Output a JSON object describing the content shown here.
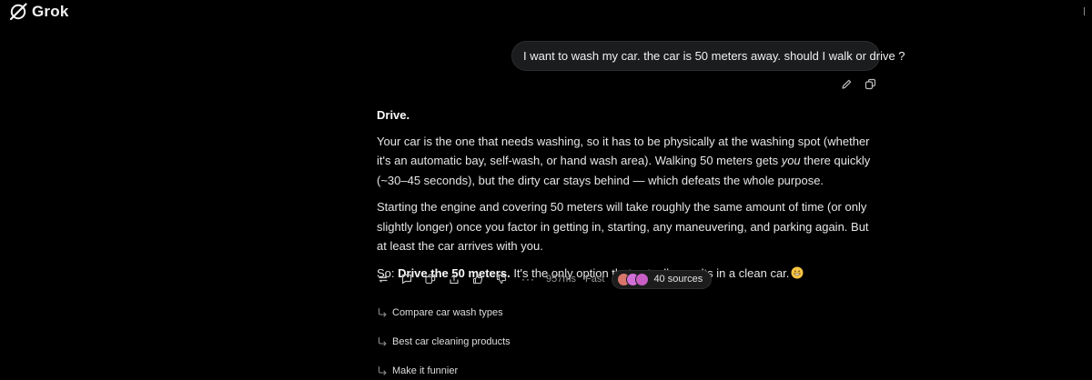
{
  "app": {
    "title": "Grok"
  },
  "colors": {
    "background": "#000000",
    "bubble": "#1b1c1d",
    "text": "#e6e6e6",
    "muted": "#9a9a9a"
  },
  "user_message": {
    "text": "I want to wash my car. the car is 50 meters away. should I walk or drive ?",
    "actions": [
      "pencil-icon",
      "copy-icon"
    ]
  },
  "response": {
    "heading": "Drive.",
    "p1_before": "Your car is the one that needs washing, so it has to be physically at the washing spot (whether it's an automatic bay, self-wash, or hand wash area). Walking 50 meters gets ",
    "p1_em": "you",
    "p1_after": " there quickly (~30–45 seconds), but the dirty car stays behind — which defeats the whole purpose.",
    "p2": "Starting the engine and covering 50 meters will take roughly the same amount of time (or only slightly longer) once you factor in getting in, starting, any maneuvering, and parking again. But at least the car arrives with you.",
    "p3_prefix": "So: ",
    "p3_bold": "Drive the 50 meters.",
    "p3_rest": " It's the only option that actually results in a clean car.",
    "p3_emoji": "grinning-face-emoji"
  },
  "toolbar": {
    "icons": [
      "regenerate-icon",
      "comment-icon",
      "copy-icon",
      "share-icon",
      "thumbs-up-icon",
      "thumbs-down-icon"
    ],
    "more_label": "···",
    "time": "957ms",
    "speed": "Fast",
    "sources_label": "40 sources",
    "source_colors": [
      "#d9766b",
      "#d26fd6",
      "#c95ec4"
    ]
  },
  "followups": [
    "Compare car wash types",
    "Best car cleaning products",
    "Make it funnier"
  ]
}
